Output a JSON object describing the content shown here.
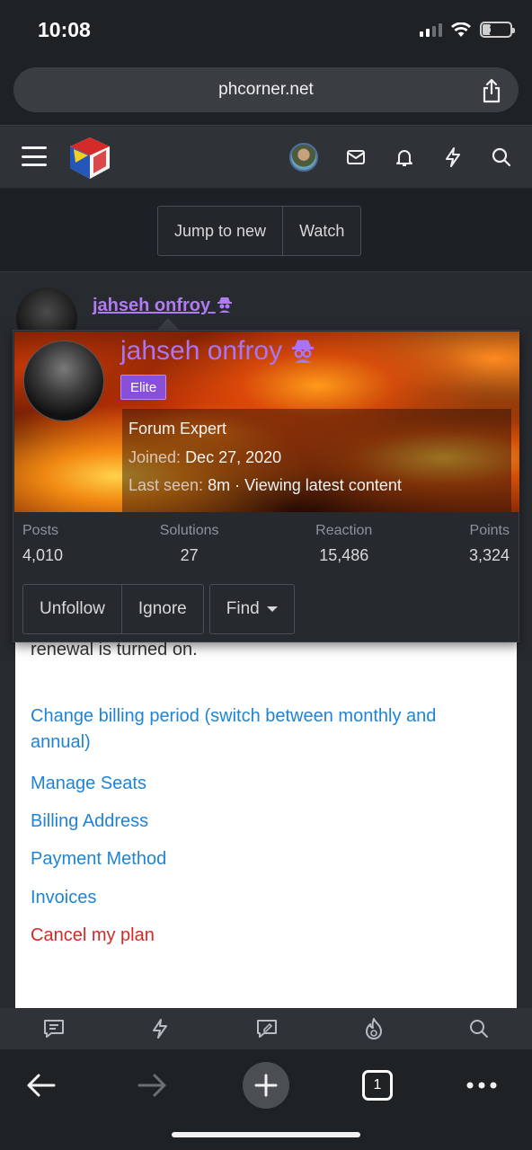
{
  "status_bar": {
    "time": "10:08",
    "battery": "27",
    "battery_level": 0.27
  },
  "browser": {
    "url": "phcorner.net"
  },
  "thread_buttons": {
    "jump_to_new": "Jump to new",
    "watch": "Watch"
  },
  "post": {
    "username": "jahseh onfroy"
  },
  "tooltip": {
    "name": "jahseh onfroy",
    "badge": "Elite",
    "title": "Forum Expert",
    "joined_label": "Joined:",
    "joined_value": "Dec 27, 2020",
    "last_seen_label": "Last seen:",
    "last_seen_value": "8m · Viewing latest content",
    "stats": [
      {
        "label": "Posts",
        "value": "4,010"
      },
      {
        "label": "Solutions",
        "value": "27"
      },
      {
        "label": "Reaction",
        "value": "15,486"
      },
      {
        "label": "Points",
        "value": "3,324"
      }
    ],
    "buttons": {
      "unfollow": "Unfollow",
      "ignore": "Ignore",
      "find": "Find"
    }
  },
  "message": {
    "renewal": "renewal is turned on.",
    "links": [
      {
        "line1": "Change billing period (switch between monthly and",
        "line2": "annual)"
      },
      {
        "line1": "Manage Seats"
      },
      {
        "line1": "Billing Address"
      },
      {
        "line1": "Payment Method"
      },
      {
        "line1": "Invoices"
      },
      {
        "line1": "Cancel my plan"
      }
    ]
  },
  "safari_toolbar": {
    "tab_count": "1"
  },
  "colors": {
    "username": "#b07cf0",
    "link": "#1f84d6",
    "cancel": "#d42828",
    "badge": "#8a4fd8"
  }
}
